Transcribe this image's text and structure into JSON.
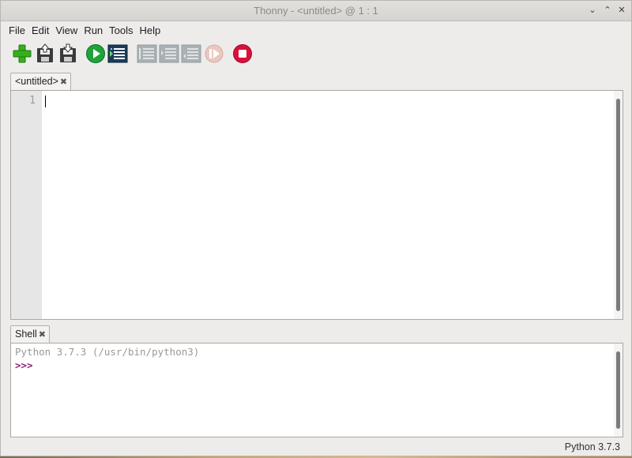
{
  "window": {
    "title": "Thonny  -  <untitled>  @  1 : 1",
    "buttons": {
      "minimize": "⌄",
      "maximize": "⌃",
      "close": "✕"
    }
  },
  "menu": [
    "File",
    "Edit",
    "View",
    "Run",
    "Tools",
    "Help"
  ],
  "toolbar": [
    {
      "name": "new-icon",
      "enabled": true
    },
    {
      "name": "load-icon",
      "enabled": true
    },
    {
      "name": "save-icon",
      "enabled": true
    },
    {
      "name": "run-icon",
      "enabled": true
    },
    {
      "name": "debug-icon",
      "enabled": true
    },
    {
      "name": "step-over-icon",
      "enabled": false
    },
    {
      "name": "step-into-icon",
      "enabled": false
    },
    {
      "name": "step-out-icon",
      "enabled": false
    },
    {
      "name": "resume-icon",
      "enabled": false
    },
    {
      "name": "stop-icon",
      "enabled": true
    }
  ],
  "editor": {
    "tab_label": "<untitled>",
    "close_glyph": "✖",
    "line_numbers": [
      "1"
    ]
  },
  "shell": {
    "tab_label": "Shell",
    "close_glyph": "✖",
    "banner": "Python 3.7.3 (/usr/bin/python3)",
    "prompt": ">>>"
  },
  "status": {
    "interpreter": "Python 3.7.3"
  },
  "colors": {
    "run_green": "#1fa33a",
    "stop_red": "#d9113a",
    "new_green": "#35b01b",
    "prompt_purple": "#8b1f6f",
    "disabled_gray": "#9aa3a6"
  }
}
